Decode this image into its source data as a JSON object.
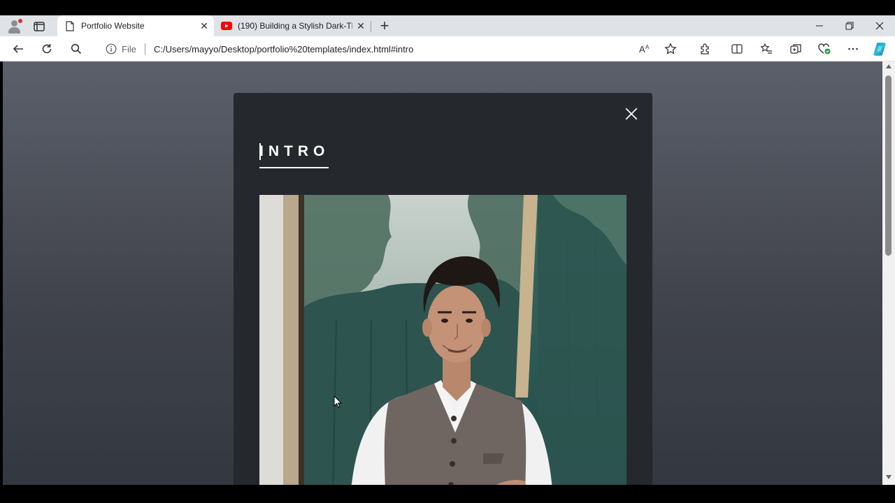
{
  "browser": {
    "tabs": [
      {
        "title": "Portfolio Website",
        "icon": "page-icon",
        "active": true
      },
      {
        "title": "(190) Building a Stylish Dark-The",
        "icon": "youtube-icon",
        "active": false
      }
    ],
    "address": {
      "scheme_label": "File",
      "url": "C:/Users/mayyo/Desktop/portfolio%20templates/index.html#intro"
    },
    "window_controls": [
      "minimize-icon",
      "restore-icon",
      "close-icon"
    ],
    "toolbar_icons": [
      "back-icon",
      "refresh-icon",
      "search-icon",
      "read-aloud-icon",
      "favorite-star-icon",
      "extensions-icon",
      "split-screen-icon",
      "favorites-icon",
      "collections-icon",
      "browser-essentials-icon",
      "more-icon",
      "copilot-icon"
    ]
  },
  "page": {
    "section_title": "INTRO",
    "photo_alt": "portrait-photo"
  },
  "colors": {
    "modal_bg": "#25282c",
    "page_bg_top": "#5b606a",
    "page_bg_bottom": "#333840",
    "youtube_red": "#ff0000",
    "copilot_accent": "#2f80ed"
  }
}
